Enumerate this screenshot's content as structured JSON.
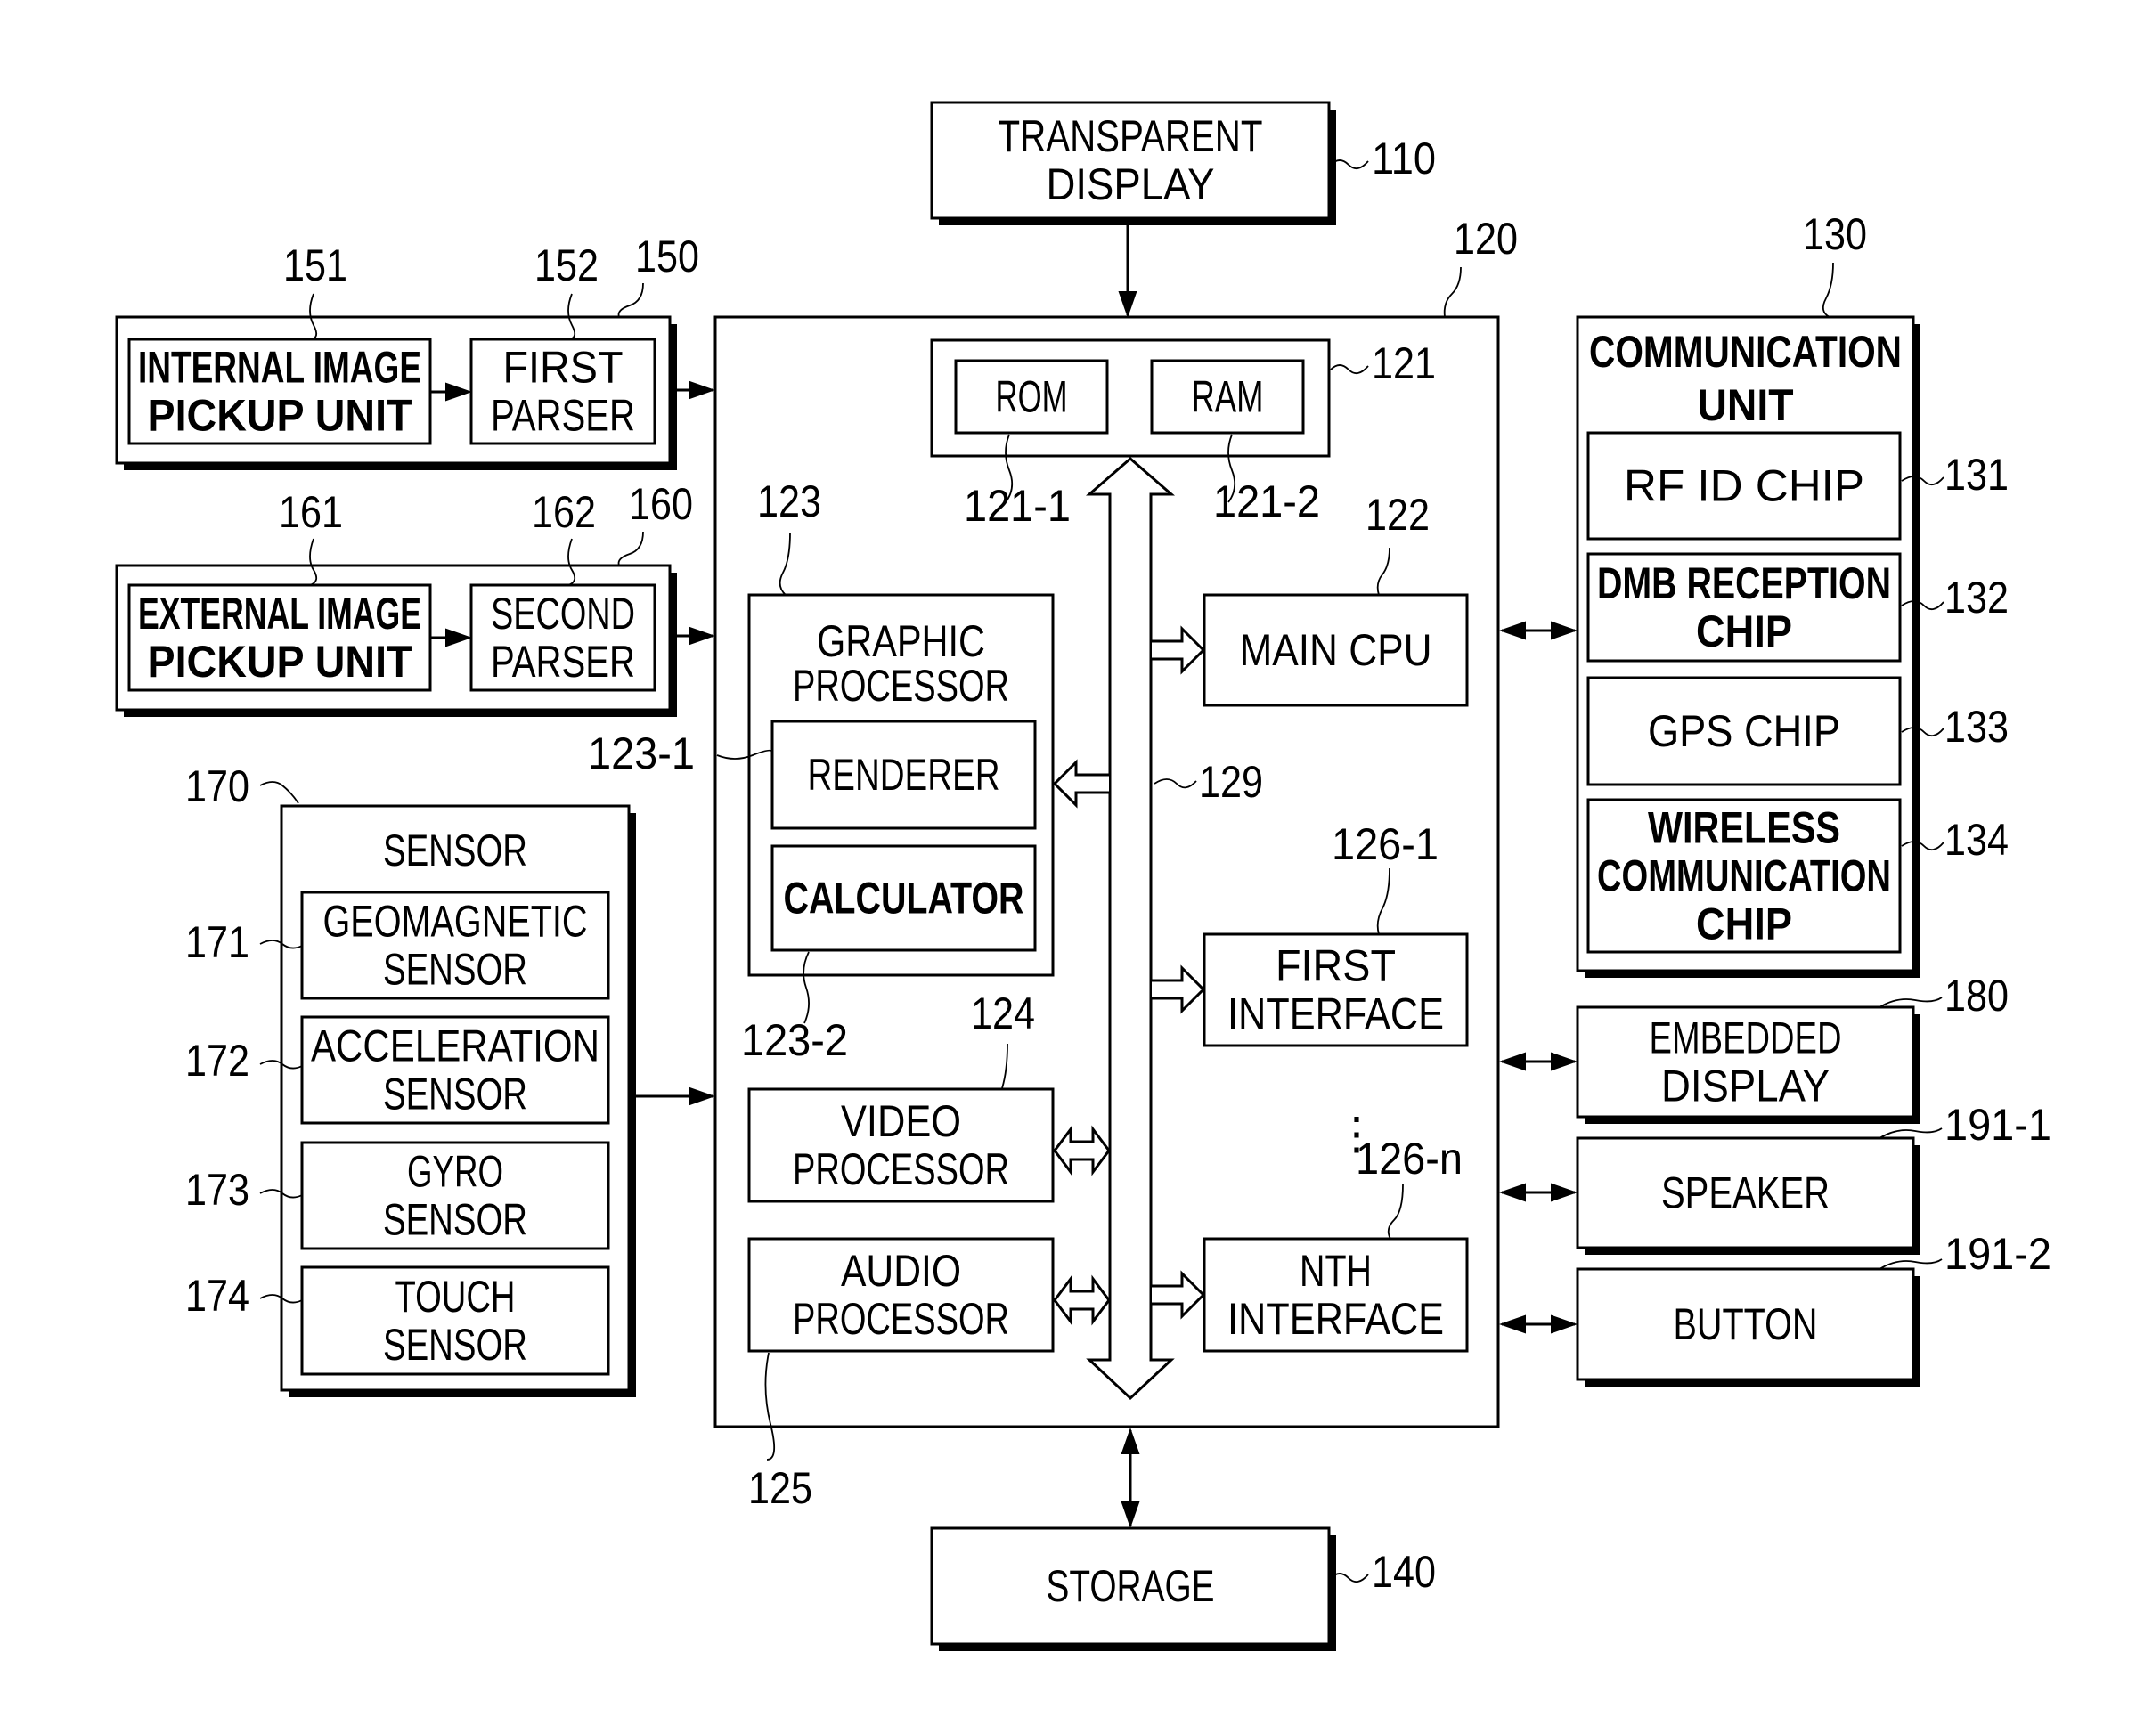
{
  "diagram": {
    "blocks": {
      "transparent_display": {
        "ref": "110",
        "lines": [
          "TRANSPARENT",
          "DISPLAY"
        ]
      },
      "controller": {
        "ref": "120"
      },
      "memory": {
        "ref": "121"
      },
      "rom": {
        "ref": "121-1",
        "lines": [
          "ROM"
        ]
      },
      "ram": {
        "ref": "121-2",
        "lines": [
          "RAM"
        ]
      },
      "main_cpu": {
        "ref": "122",
        "lines": [
          "MAIN CPU"
        ]
      },
      "graphic_processor": {
        "ref": "123",
        "lines": [
          "GRAPHIC",
          "PROCESSOR"
        ]
      },
      "renderer": {
        "ref": "123-1",
        "lines": [
          "RENDERER"
        ]
      },
      "calculator": {
        "ref": "123-2",
        "lines": [
          "CALCULATOR"
        ]
      },
      "video_processor": {
        "ref": "124",
        "lines": [
          "VIDEO",
          "PROCESSOR"
        ]
      },
      "audio_processor": {
        "ref": "125",
        "lines": [
          "AUDIO",
          "PROCESSOR"
        ]
      },
      "first_interface": {
        "ref": "126-1",
        "lines": [
          "FIRST",
          "INTERFACE"
        ]
      },
      "nth_interface": {
        "ref": "126-n",
        "lines": [
          "NTH",
          "INTERFACE"
        ]
      },
      "bus": {
        "ref": "129"
      },
      "communication_unit": {
        "ref": "130",
        "lines": [
          "COMMUNICATION",
          "UNIT"
        ]
      },
      "rfid_chip": {
        "ref": "131",
        "lines": [
          "RF ID CHIP"
        ]
      },
      "dmb_chip": {
        "ref": "132",
        "lines": [
          "DMB RECEPTION",
          "CHIP"
        ]
      },
      "gps_chip": {
        "ref": "133",
        "lines": [
          "GPS CHIP"
        ]
      },
      "wireless_chip": {
        "ref": "134",
        "lines": [
          "WIRELESS",
          "COMMUNICATION",
          "CHIP"
        ]
      },
      "storage": {
        "ref": "140",
        "lines": [
          "STORAGE"
        ]
      },
      "image_unit_1": {
        "ref": "150"
      },
      "internal_pickup": {
        "ref": "151",
        "lines": [
          "INTERNAL IMAGE",
          "PICKUP UNIT"
        ]
      },
      "first_parser": {
        "ref": "152",
        "lines": [
          "FIRST",
          "PARSER"
        ]
      },
      "image_unit_2": {
        "ref": "160"
      },
      "external_pickup": {
        "ref": "161",
        "lines": [
          "EXTERNAL IMAGE",
          "PICKUP UNIT"
        ]
      },
      "second_parser": {
        "ref": "162",
        "lines": [
          "SECOND",
          "PARSER"
        ]
      },
      "sensor": {
        "ref": "170",
        "lines": [
          "SENSOR"
        ]
      },
      "geomagnetic": {
        "ref": "171",
        "lines": [
          "GEOMAGNETIC",
          "SENSOR"
        ]
      },
      "acceleration": {
        "ref": "172",
        "lines": [
          "ACCELERATION",
          "SENSOR"
        ]
      },
      "gyro": {
        "ref": "173",
        "lines": [
          "GYRO",
          "SENSOR"
        ]
      },
      "touch": {
        "ref": "174",
        "lines": [
          "TOUCH",
          "SENSOR"
        ]
      },
      "embedded_display": {
        "ref": "180",
        "lines": [
          "EMBEDDED",
          "DISPLAY"
        ]
      },
      "speaker": {
        "ref": "191-1",
        "lines": [
          "SPEAKER"
        ]
      },
      "button": {
        "ref": "191-2",
        "lines": [
          "BUTTON"
        ]
      }
    },
    "ellipsis": "⋮"
  }
}
